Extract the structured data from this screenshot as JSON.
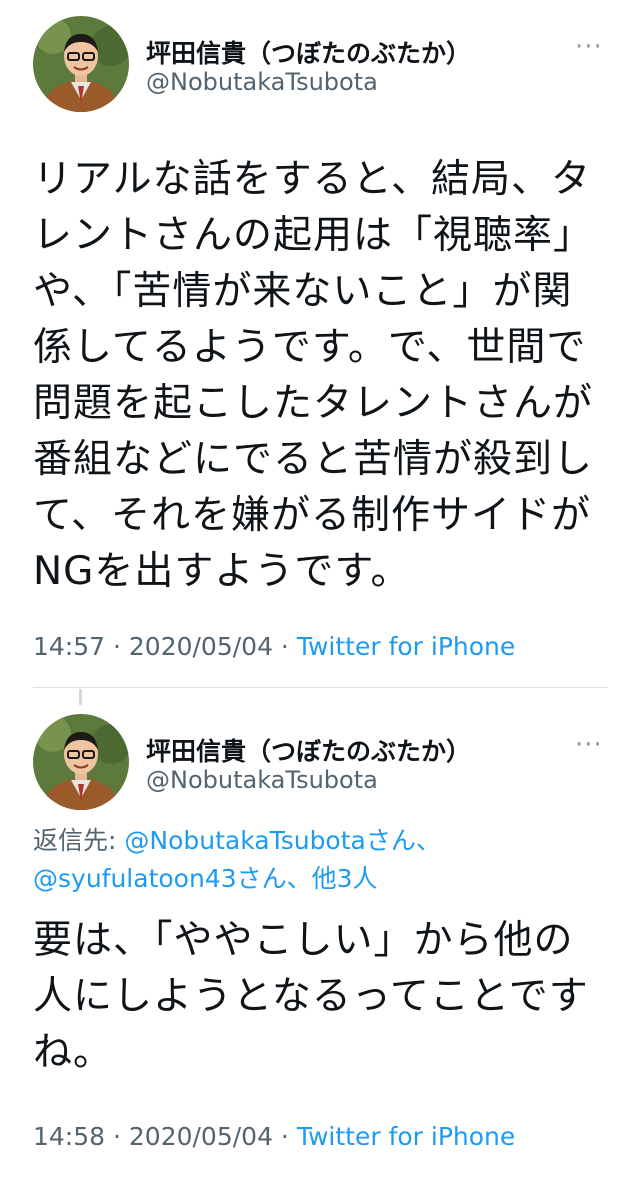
{
  "tweets": [
    {
      "display_name": "坪田信貴（つぼたのぶたか）",
      "handle": "@NobutakaTsubota",
      "more_glyph": "···",
      "text_lines": [
        "リアルな話をすると、結局、タ",
        "レントさんの起用は「視聴率」",
        "や、「苦情が来ないこと」が関",
        "係してるようです。で、世間で",
        "問題を起こしたタレントさんが",
        "番組などにでると苦情が殺到し",
        "て、それを嫌がる制作サイドが",
        "NGを出すようです。"
      ],
      "time": "14:57",
      "date": "2020/05/04",
      "separator": " · ",
      "source": "Twitter for iPhone"
    },
    {
      "display_name": "坪田信貴（つぼたのぶたか）",
      "handle": "@NobutakaTsubota",
      "more_glyph": "···",
      "replying_prefix": "返信先: ",
      "replying_mention1": "@NobutakaTsubotaさん、",
      "replying_mention2": "@syufulatoon43さん、他3人",
      "text_lines": [
        "要は、「ややこしい」から他の",
        "人にしようとなるってことです",
        "ね。"
      ],
      "time": "14:58",
      "date": "2020/05/04",
      "separator": " · ",
      "source": "Twitter for iPhone"
    }
  ],
  "colors": {
    "accent": "#1d9bf0",
    "secondary_text": "#536471",
    "divider": "#dfe3e7"
  }
}
